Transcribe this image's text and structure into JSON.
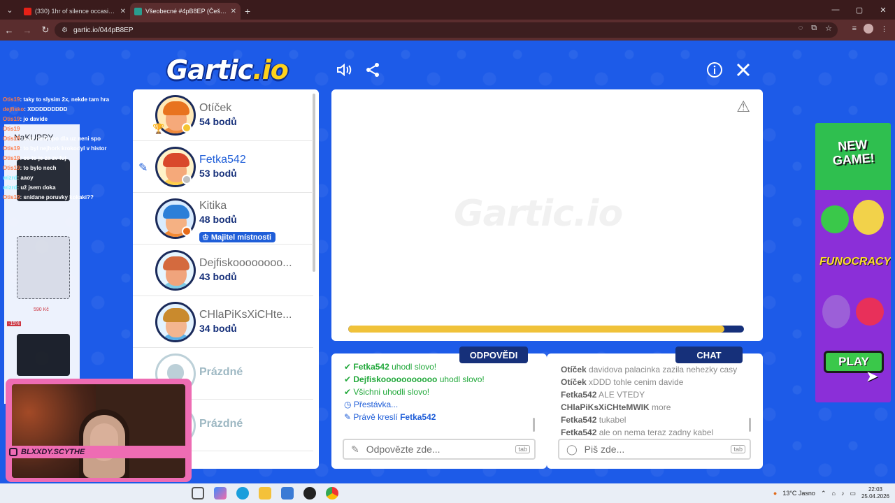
{
  "browser": {
    "tabs": [
      {
        "title": "(330) 1hr of silence occasionall",
        "active": false,
        "favicon_color": "#e62117"
      },
      {
        "title": "Všeobecné #4pB8EP (Čeština) -",
        "active": true,
        "favicon_color": "#2a9d8f"
      }
    ],
    "url": "gartic.io/044pB8EP",
    "new_tab_label": "+",
    "window_controls": [
      "—",
      "▢",
      "✕"
    ]
  },
  "game": {
    "logo_main": "Gartic",
    "logo_io": ".io",
    "players": [
      {
        "name": "Otíček",
        "points": "54 bodů",
        "me": false,
        "status_color": "#f4c431",
        "skin": "#f5a97a",
        "hair": "#e8731f",
        "shirt": "#f08a3c",
        "trophy": true
      },
      {
        "name": "Fetka542",
        "points": "53 bodů",
        "me": true,
        "status_color": "#bfbfbf",
        "skin": "#f5a97a",
        "hair": "#d9482b",
        "shirt": "#ffcf4a",
        "drawing": true
      },
      {
        "name": "Kitika",
        "points": "48 bodů",
        "me": false,
        "status_color": "#e66b1a",
        "skin": "#f5b183",
        "hair": "#2c7fd8",
        "shirt": "#f28a35",
        "owner": "Majitel místnosti"
      },
      {
        "name": "Dejfiskoooooooo...",
        "points": "43 bodů",
        "me": false,
        "status_color": null,
        "skin": "#f0a47c",
        "hair": "#d46a3e",
        "shirt": "#7fcbe6"
      },
      {
        "name": "CHlaPiKsXiCHte...",
        "points": "34 bodů",
        "me": false,
        "status_color": null,
        "skin": "#f3b58f",
        "hair": "#c98a2d",
        "shirt": "#5ab0e8"
      },
      {
        "name": "Prázdné",
        "empty": true
      },
      {
        "name": "Prázdné",
        "empty": true
      }
    ],
    "canvas_watermark": "Gartic.io",
    "timer_fraction": 0.95,
    "answers_tab": "ODPOVĚDI",
    "chat_tab": "CHAT",
    "answers_feed": [
      {
        "kind": "ok",
        "user": "Fetka542",
        "text": " uhodl slovo!"
      },
      {
        "kind": "ok",
        "user": "Dejfiskooooooooooo",
        "text": " uhodl slovo!"
      },
      {
        "kind": "ok",
        "user": "",
        "text": "Všichni uhodli slovo!"
      },
      {
        "kind": "sys",
        "user": "",
        "text": "Přestávka..."
      },
      {
        "kind": "sys",
        "user": "Fetka542",
        "text": "Právě kreslí "
      }
    ],
    "chat_feed": [
      {
        "user": "Otíček",
        "text": " davidova palacinka zazila nehezky casy"
      },
      {
        "user": "Otíček",
        "text": " xDDD tohle cenim davide"
      },
      {
        "user": "Fetka542",
        "text": " ALE VTEDY"
      },
      {
        "user": "CHlaPiKsXiCHteMWIK",
        "text": " more"
      },
      {
        "user": "Fetka542",
        "text": " tukabel"
      },
      {
        "user": "Fetka542",
        "text": " ale on nema teraz zadny kabel"
      }
    ],
    "answer_placeholder": "Odpovězte zde...",
    "chat_placeholder": "Piš zde...",
    "tab_key": "tab"
  },
  "overlay": {
    "stream_chat": [
      {
        "user": "Otis19",
        "text": ": taky to slysim 2x, nekde tam hra"
      },
      {
        "user": "dejfisko",
        "text": ": XDDDDDDDDD"
      },
      {
        "user": "Otis19",
        "text": ": jo davide"
      },
      {
        "user": "Otis19",
        "text": ""
      },
      {
        "user": "Otis19",
        "text": ": a uz neni spo dla uz neni spo"
      },
      {
        "user": "Otis19",
        "text": ": to byl nejhork krokodyl v histor"
      },
      {
        "user": "Otis19",
        "text": ": co to je za zv fuj"
      },
      {
        "user": "Otis19",
        "text": ": to bylo nech"
      },
      {
        "user": "wizrd",
        "text": ": aaoy"
      },
      {
        "user": "wizrd",
        "text": ": už jsem doka"
      },
      {
        "user": "Otis19",
        "text": ": snidane poruvky kokaki??"
      }
    ],
    "ad_brand": "NaKUPRY",
    "ad_price_1": "590 Kč",
    "ad_discount": "-15%",
    "handle": "BLXXDY.SCYTHE",
    "ad_right": {
      "new_game": "NEW GAME!",
      "funocracy": "FUNOCRACY",
      "play": "PLAY"
    }
  },
  "taskbar": {
    "weather": "13°C  Jasno",
    "time": "22:03",
    "date": "25.04.2026"
  }
}
